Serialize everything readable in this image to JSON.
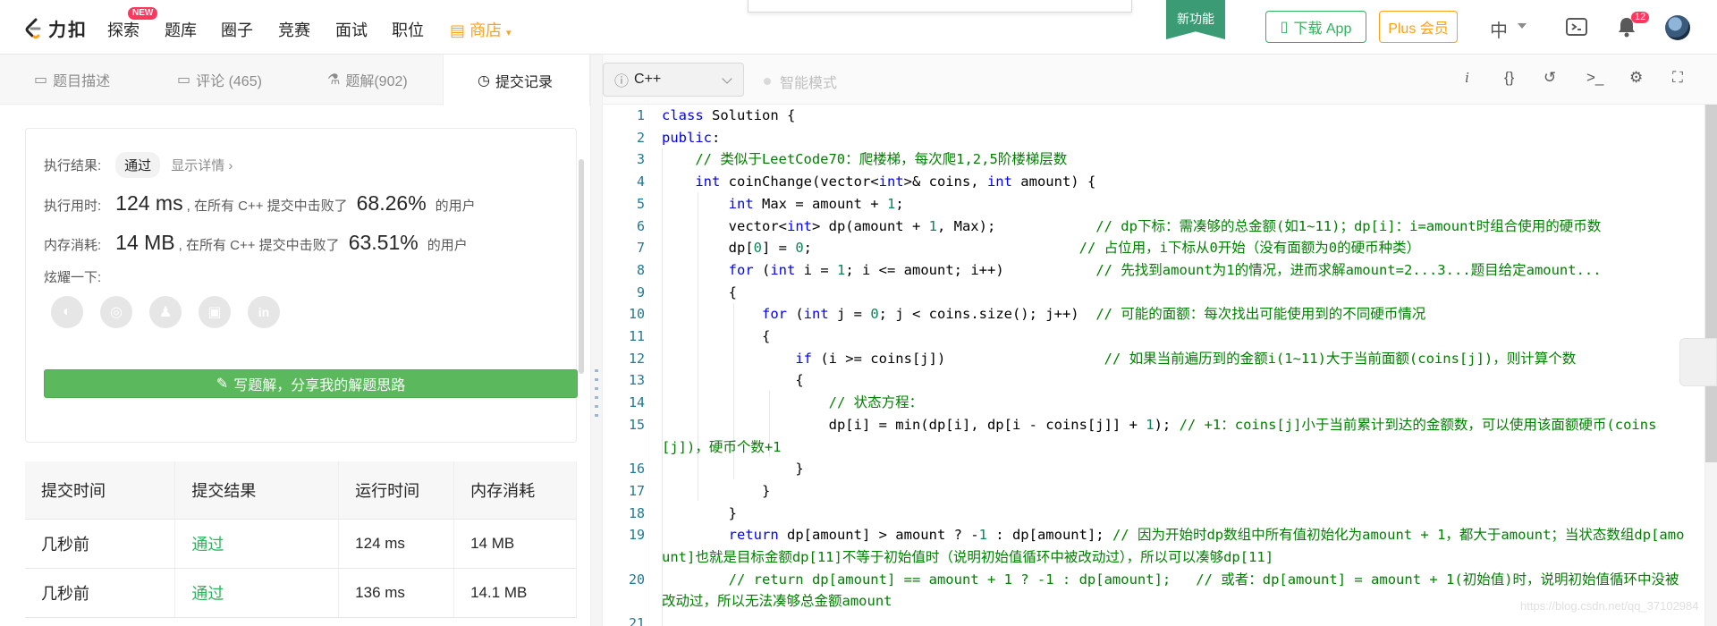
{
  "nav": {
    "brand": "力扣",
    "items": [
      "探索",
      "题库",
      "圈子",
      "竞赛",
      "面试",
      "职位"
    ],
    "new_badge": "NEW",
    "shop": "商店",
    "new_feature": "新功能",
    "download": "下载 App",
    "plus": "Plus 会员",
    "lang": "中",
    "notifications": "12"
  },
  "tabs": [
    {
      "label": "题目描述",
      "icon": "description-icon"
    },
    {
      "label": "评论 (465)",
      "icon": "comment-icon"
    },
    {
      "label": "题解(902)",
      "icon": "flask-icon"
    },
    {
      "label": "提交记录",
      "icon": "clock-icon"
    }
  ],
  "result": {
    "status_label": "执行结果:",
    "status_value": "通过",
    "detail": "显示详情 ›",
    "time_label": "执行用时:",
    "time_value": "124 ms",
    "time_text": ", 在所有 C++ 提交中击败了",
    "time_pct": "68.26%",
    "time_suffix": "的用户",
    "mem_label": "内存消耗:",
    "mem_value": "14 MB",
    "mem_text": ", 在所有 C++ 提交中击败了",
    "mem_pct": "63.51%",
    "mem_suffix": "的用户",
    "share_label": "炫耀一下:",
    "share_icons": [
      "wechat-icon",
      "weibo-icon",
      "qq-icon",
      "douban-icon",
      "linkedin-icon"
    ],
    "write_button": "写题解，分享我的解题思路"
  },
  "submissions": {
    "headers": [
      "提交时间",
      "提交结果",
      "运行时间",
      "内存消耗"
    ],
    "rows": [
      [
        "几秒前",
        "通过",
        "124 ms",
        "14 MB"
      ],
      [
        "几秒前",
        "通过",
        "136 ms",
        "14.1 MB"
      ]
    ]
  },
  "editor": {
    "language": "C++",
    "smart_mode": "智能模式",
    "line_numbers": [
      "1",
      "2",
      "3",
      "4",
      "5",
      "6",
      "7",
      "8",
      "9",
      "10",
      "11",
      "12",
      "13",
      "14",
      "15",
      "16",
      "17",
      "18",
      "19",
      "20",
      "21"
    ]
  },
  "watermark": "https://blog.csdn.net/qq_37102984"
}
